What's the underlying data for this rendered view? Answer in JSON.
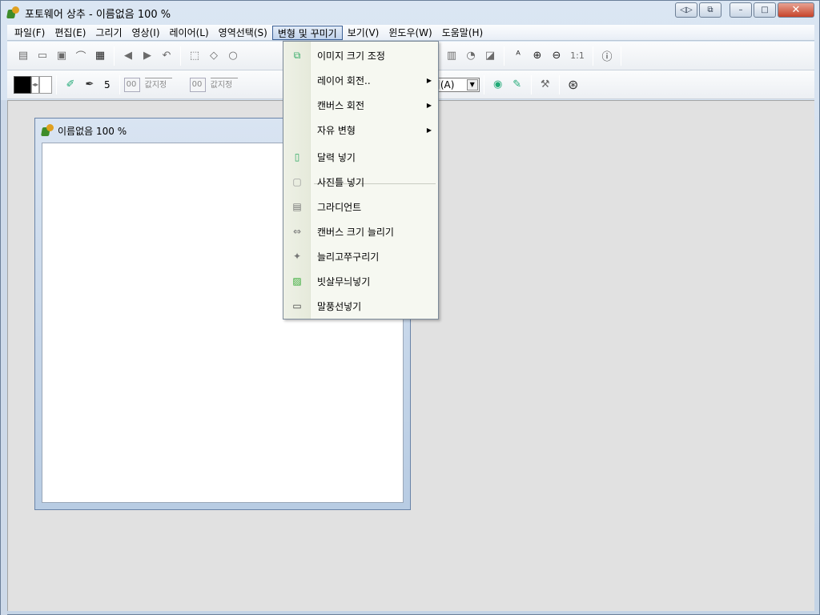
{
  "window": {
    "title": "포토웨어 상추 - 이름없음 100 %",
    "close_glyph": "✕",
    "min_glyph": "–",
    "max_glyph": "□",
    "extra1_glyph": "◁▷",
    "extra2_glyph": "⧉"
  },
  "menubar": {
    "items": [
      "파일(F)",
      "편집(E)",
      "그리기",
      "영상(I)",
      "레이어(L)",
      "영역선택(S)",
      "변형 및 꾸미기",
      "보기(V)",
      "윈도우(W)",
      "도움말(H)"
    ]
  },
  "toolbar2": {
    "brush_size": "5",
    "input1": "00",
    "input2": "00",
    "value_label1": "값지정",
    "value_label2": "값지정",
    "noise_select": "노이즈제거(A)",
    "arrow": "▼",
    "ratio_label": "1:1"
  },
  "document": {
    "title": "이름없음 100 %"
  },
  "dropdown": {
    "items": [
      {
        "label": "이미지 크기 조정",
        "icon": "resize-icon",
        "submenu": false
      },
      {
        "label": "레이어 회전..",
        "icon": "",
        "submenu": true
      },
      {
        "label": "캔버스 회전",
        "icon": "",
        "submenu": true
      },
      {
        "label": "자유 변형",
        "icon": "",
        "submenu": true
      },
      {
        "label": "달력 넣기",
        "icon": "calendar-icon",
        "submenu": false
      },
      {
        "label": "사진틀 넣기",
        "icon": "frame-icon",
        "submenu": false
      },
      {
        "label": "그라디언트",
        "icon": "gradient-icon",
        "submenu": false
      },
      {
        "label": "캔버스 크기 늘리기",
        "icon": "expand-canvas-icon",
        "submenu": false
      },
      {
        "label": "늘리고쭈구리기",
        "icon": "stretch-icon",
        "submenu": false
      },
      {
        "label": "빗살무늬넣기",
        "icon": "hatch-icon",
        "submenu": false
      },
      {
        "label": "말풍선넣기",
        "icon": "speech-bubble-icon",
        "submenu": false
      }
    ],
    "submenu_glyph": "▶"
  }
}
